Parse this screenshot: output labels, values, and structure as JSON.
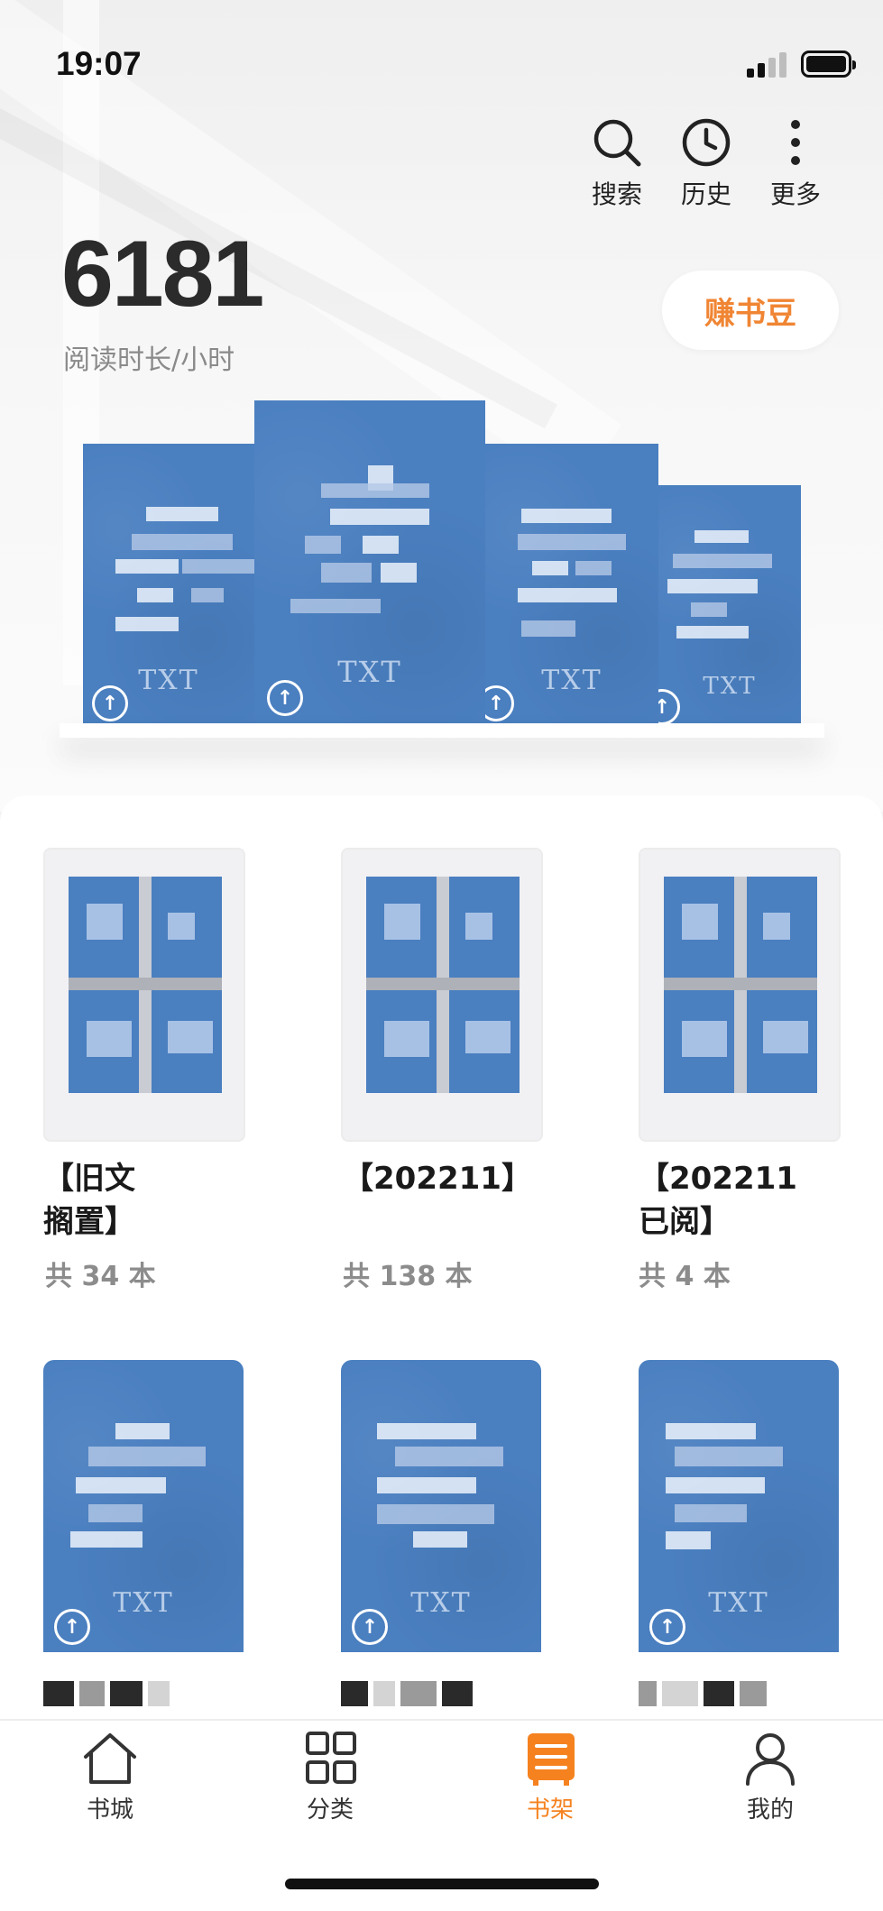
{
  "status_bar": {
    "time": "19:07"
  },
  "header": {
    "actions": [
      {
        "label": "搜索",
        "icon": "search-icon"
      },
      {
        "label": "历史",
        "icon": "clock-icon"
      },
      {
        "label": "更多",
        "icon": "more-vertical-icon"
      }
    ],
    "reading_hours": "6181",
    "reading_hours_label": "阅读时长/小时",
    "earn_button": "赚书豆"
  },
  "shelf_books": [
    {
      "cover_text": "TXT"
    },
    {
      "cover_text": "TXT"
    },
    {
      "cover_text": "TXT"
    },
    {
      "cover_text": "TXT"
    }
  ],
  "folders": [
    {
      "title_line1": "【旧文",
      "title_line2": "搁置】",
      "count": "共 34 本"
    },
    {
      "title_line1": "【202211】",
      "title_line2": "",
      "count": "共 138 本"
    },
    {
      "title_line1": "【202211",
      "title_line2": "已阅】",
      "count": "共 4 本"
    }
  ],
  "books": [
    {
      "cover_text": "TXT"
    },
    {
      "cover_text": "TXT"
    },
    {
      "cover_text": "TXT"
    }
  ],
  "tabbar": [
    {
      "label": "书城",
      "icon": "home-icon"
    },
    {
      "label": "分类",
      "icon": "grid-icon"
    },
    {
      "label": "书架",
      "icon": "bookshelf-icon",
      "active": true
    },
    {
      "label": "我的",
      "icon": "user-icon"
    }
  ],
  "colors": {
    "accent": "#f5821f",
    "cover": "#4a7fc0"
  }
}
